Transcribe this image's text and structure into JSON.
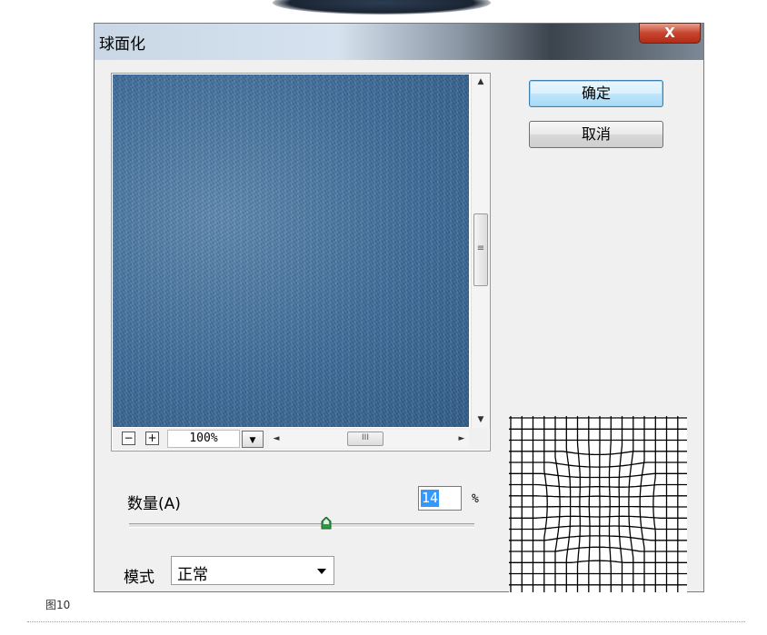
{
  "window": {
    "title": "球面化",
    "close_label": "X"
  },
  "buttons": {
    "ok_label": "确定",
    "cancel_label": "取消"
  },
  "preview": {
    "zoom_value": "100%",
    "zoom_out_label": "−",
    "zoom_in_label": "+",
    "scroll_grip": "III",
    "scroll_grip_v": "≡"
  },
  "amount": {
    "label": "数量(A)",
    "value": "14",
    "unit": "%",
    "slider_min": -100,
    "slider_max": 100,
    "slider_value": 14
  },
  "mode": {
    "label": "模式",
    "value": "正常"
  },
  "grid_preview": {
    "lines": 17,
    "amount": 14
  },
  "caption": "图10",
  "colors": {
    "selection": "#3399ff",
    "default_button_border": "#3c7fb1",
    "close_button": "#c7442d",
    "denim": "#3d6a96"
  }
}
